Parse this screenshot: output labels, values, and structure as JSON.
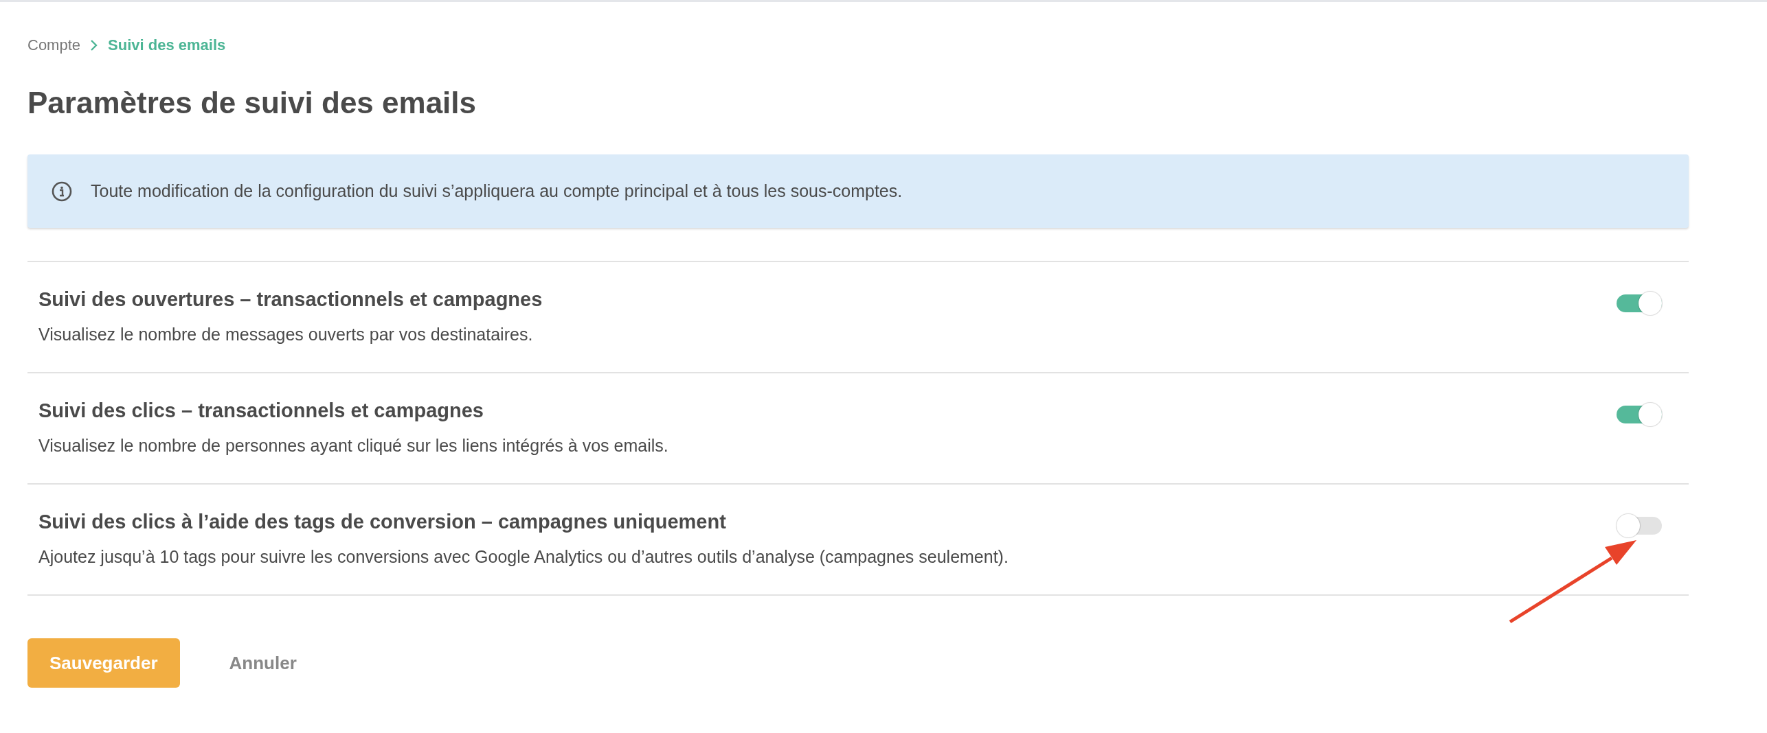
{
  "breadcrumb": [
    {
      "label": "Compte",
      "selected": false
    },
    {
      "label": "Suivi des emails",
      "selected": true
    }
  ],
  "title": "Paramètres de suivi des emails",
  "info_banner": {
    "text": "Toute modification de la configuration du suivi s’appliquera au compte principal et à tous les sous-comptes."
  },
  "settings": [
    {
      "title": "Suivi des ouvertures – transactionnels et campagnes",
      "description": "Visualisez le nombre de messages ouverts par vos destinataires.",
      "on": true
    },
    {
      "title": "Suivi des clics – transactionnels et campagnes",
      "description": "Visualisez le nombre de personnes ayant cliqué sur les liens intégrés à vos emails.",
      "on": true
    },
    {
      "title": "Suivi des clics à l’aide des tags de conversion – campagnes uniquement",
      "description": "Ajoutez jusqu’à 10 tags pour suivre les conversions avec Google Analytics ou d’autres outils d’analyse (campagnes seulement).",
      "on": false
    }
  ],
  "buttons": [
    {
      "label": "Sauvegarder",
      "kind": "primary"
    },
    {
      "label": "Annuler",
      "kind": "link"
    }
  ]
}
